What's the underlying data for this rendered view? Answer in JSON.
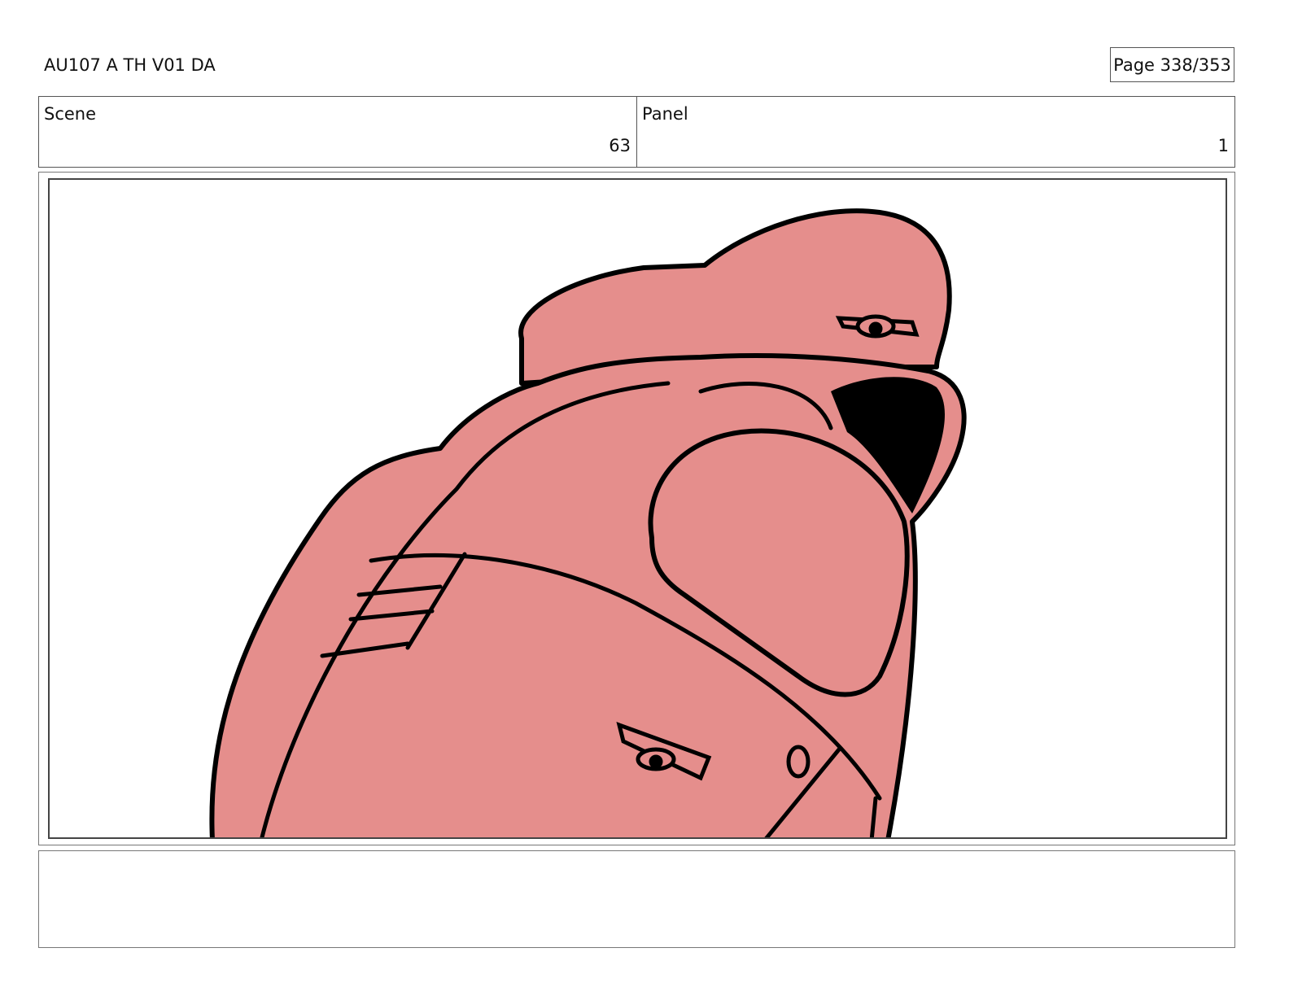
{
  "header": {
    "title": "AU107 A TH V01 DA",
    "page": "Page 338/353"
  },
  "info": {
    "scene_label": "Scene",
    "scene_value": "63",
    "panel_label": "Panel",
    "panel_value": "1"
  },
  "panel": {
    "fill_color": "#E58E8C",
    "line_color": "#000000"
  },
  "notes": {}
}
